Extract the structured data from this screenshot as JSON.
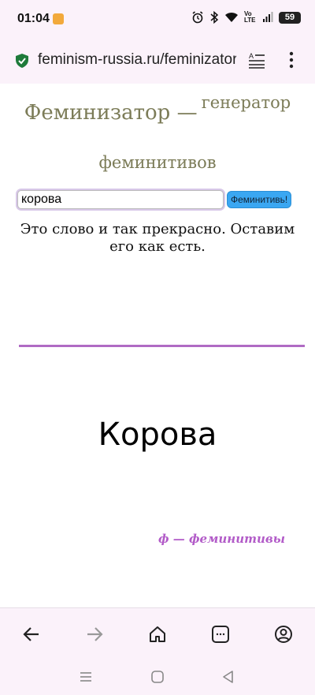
{
  "status": {
    "time": "01:04",
    "battery": "59",
    "network": "Vo LTE"
  },
  "browser": {
    "url": "feminism-russia.ru/feminizator"
  },
  "page": {
    "title_main": "Феминизатор —",
    "title_sub": "генератор",
    "title_line2": "феминитивов",
    "input": {
      "value": "корова"
    },
    "button_label": "Феминитивь!",
    "result_message": "Это слово и так прекрасно. Оставим его как есть.",
    "big_word": "Корова",
    "brand": "ф — феминитивы",
    "colors": {
      "title": "#7c7c58",
      "divider": "#b06bc4",
      "brand": "#b25bc8",
      "button": "#3aa7f2"
    }
  },
  "icons": {
    "toolbar": [
      "back-arrow-icon",
      "forward-arrow-icon",
      "home-icon",
      "tabs-icon",
      "account-icon"
    ],
    "system": [
      "recents-icon",
      "home-circle-icon",
      "back-triangle-icon"
    ]
  }
}
